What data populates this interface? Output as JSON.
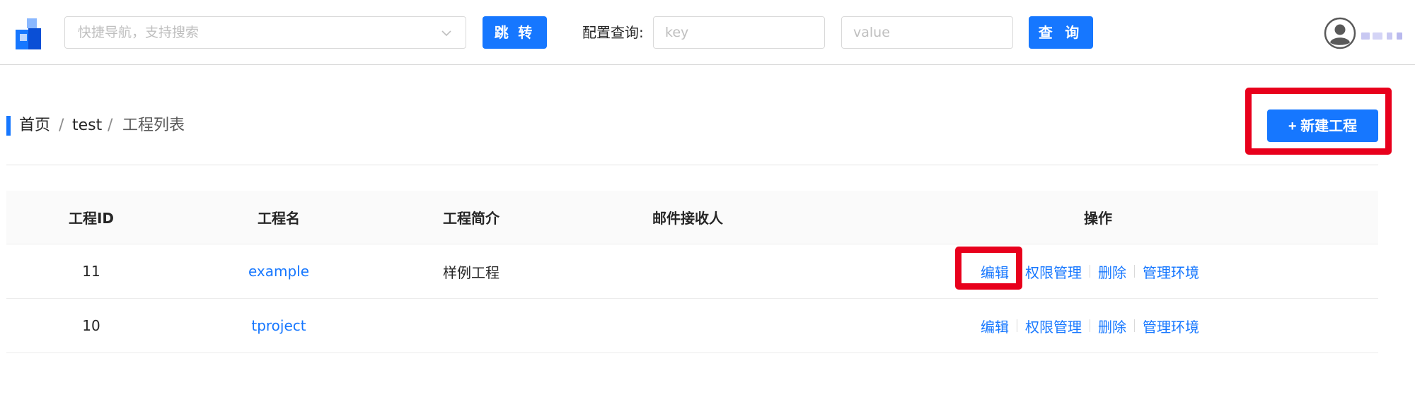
{
  "header": {
    "nav_placeholder": "快捷导航，支持搜索",
    "jump_label": "跳 转",
    "config_label": "配置查询:",
    "key_placeholder": "key",
    "value_placeholder": "value",
    "query_label": "查 询"
  },
  "breadcrumb": {
    "home": "首页",
    "separator": "/",
    "project": "test",
    "current": "工程列表"
  },
  "actions": {
    "new_project_label": "+ 新建工程"
  },
  "table": {
    "columns": [
      "工程ID",
      "工程名",
      "工程简介",
      "邮件接收人",
      "操作"
    ],
    "rows": [
      {
        "id": "11",
        "name": "example",
        "description": "样例工程",
        "mail": "",
        "ops": [
          "编辑",
          "权限管理",
          "删除",
          "管理环境"
        ]
      },
      {
        "id": "10",
        "name": "tproject",
        "description": "",
        "mail": "",
        "ops": [
          "编辑",
          "权限管理",
          "删除",
          "管理环境"
        ]
      }
    ]
  },
  "colors": {
    "primary": "#1677ff",
    "highlight": "#e8001c"
  },
  "icons": [
    "app-logo-icon",
    "chevron-down-icon",
    "user-avatar-icon"
  ]
}
